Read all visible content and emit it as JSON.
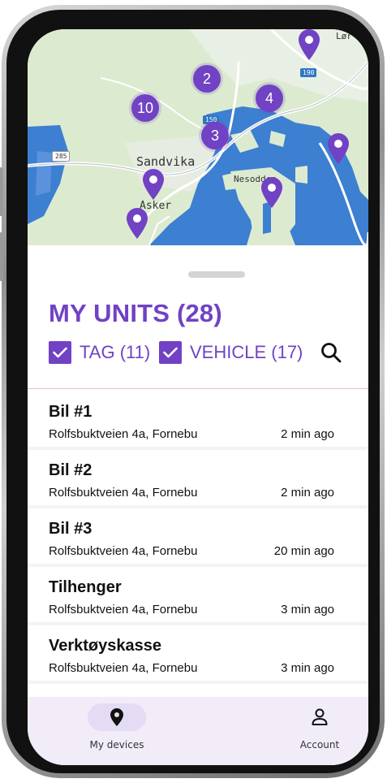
{
  "map": {
    "place_labels": [
      "Sandvika",
      "Asker",
      "Nesodden",
      "Lør"
    ],
    "road_badges": [
      "190",
      "150",
      "285"
    ],
    "clusters": [
      {
        "label": "2"
      },
      {
        "label": "10"
      },
      {
        "label": "4"
      },
      {
        "label": "3"
      }
    ],
    "single_markers": [
      "location-pin-icon",
      "location-pin-icon",
      "location-pin-icon",
      "location-pin-icon",
      "location-pin-icon"
    ]
  },
  "units": {
    "title": "MY UNITS (28)",
    "filters": [
      {
        "label": "TAG (11)",
        "checked": true
      },
      {
        "label": "VEHICLE (17)",
        "checked": true
      }
    ],
    "search_icon": "search-icon"
  },
  "devices": [
    {
      "name": "Bil #1",
      "address": "Rolfsbuktveien 4a, Fornebu",
      "time": "2 min ago"
    },
    {
      "name": "Bil #2",
      "address": "Rolfsbuktveien 4a, Fornebu",
      "time": "2 min ago"
    },
    {
      "name": "Bil #3",
      "address": "Rolfsbuktveien 4a, Fornebu",
      "time": "20 min ago"
    },
    {
      "name": "Tilhenger",
      "address": "Rolfsbuktveien 4a, Fornebu",
      "time": "3 min ago"
    },
    {
      "name": "Verktøyskasse",
      "address": "Rolfsbuktveien 4a, Fornebu",
      "time": "3 min ago"
    }
  ],
  "nav": {
    "items": [
      {
        "label": "My devices",
        "icon": "location-pin-icon",
        "active": true
      },
      {
        "label": "Account",
        "icon": "person-icon",
        "active": false
      }
    ]
  },
  "colors": {
    "accent": "#7142c4",
    "nav_background": "#f1ecf8",
    "water": "#3d7fd1",
    "land": "#dcebd0"
  }
}
